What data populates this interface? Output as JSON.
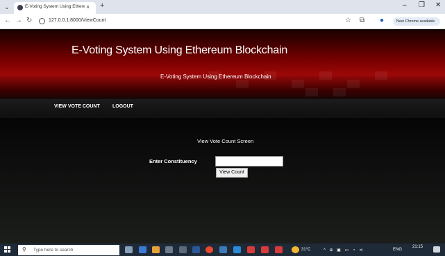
{
  "browser": {
    "tab_title": "E-Voting System Using Ethereu",
    "tab_close": "×",
    "new_tab": "+",
    "url": "127.0.0.1:8000/ViewCount",
    "chrome_badge": "New Chrome available",
    "window_controls": {
      "minimize": "–",
      "maximize": "❐",
      "close": "✕"
    },
    "icons": [
      "tab-search-icon",
      "back-icon",
      "forward-icon",
      "reload-icon",
      "site-info-icon",
      "star-icon",
      "extensions-icon",
      "profile-icon",
      "menu-icon"
    ]
  },
  "banner": {
    "title": "E-Voting System Using Ethereum Blockchain",
    "subtitle": "E-Voting System Using Ethereum Blockchain"
  },
  "nav": {
    "items": [
      {
        "label": "VIEW VOTE COUNT"
      },
      {
        "label": "LOGOUT"
      }
    ]
  },
  "form": {
    "screen_title": "View Vote Count Screen",
    "field_label": "Enter Constituency",
    "field_value": "",
    "button_label": "View Count"
  },
  "taskbar": {
    "search_placeholder": "Type here to search",
    "temperature": "31°C",
    "language": "ENG",
    "time": "21:15",
    "icons": [
      "windows-start-icon",
      "task-view-icon",
      "file-explorer-icon",
      "store-icon",
      "mail-icon",
      "photos-icon",
      "chrome-icon",
      "python-icon",
      "vscode-icon",
      "app-red-icon",
      "weather-icon",
      "notification-icon"
    ]
  },
  "colors": {
    "banner_red": "#9c0808",
    "page_bg": "#101110",
    "taskbar": "#1f2a38"
  }
}
